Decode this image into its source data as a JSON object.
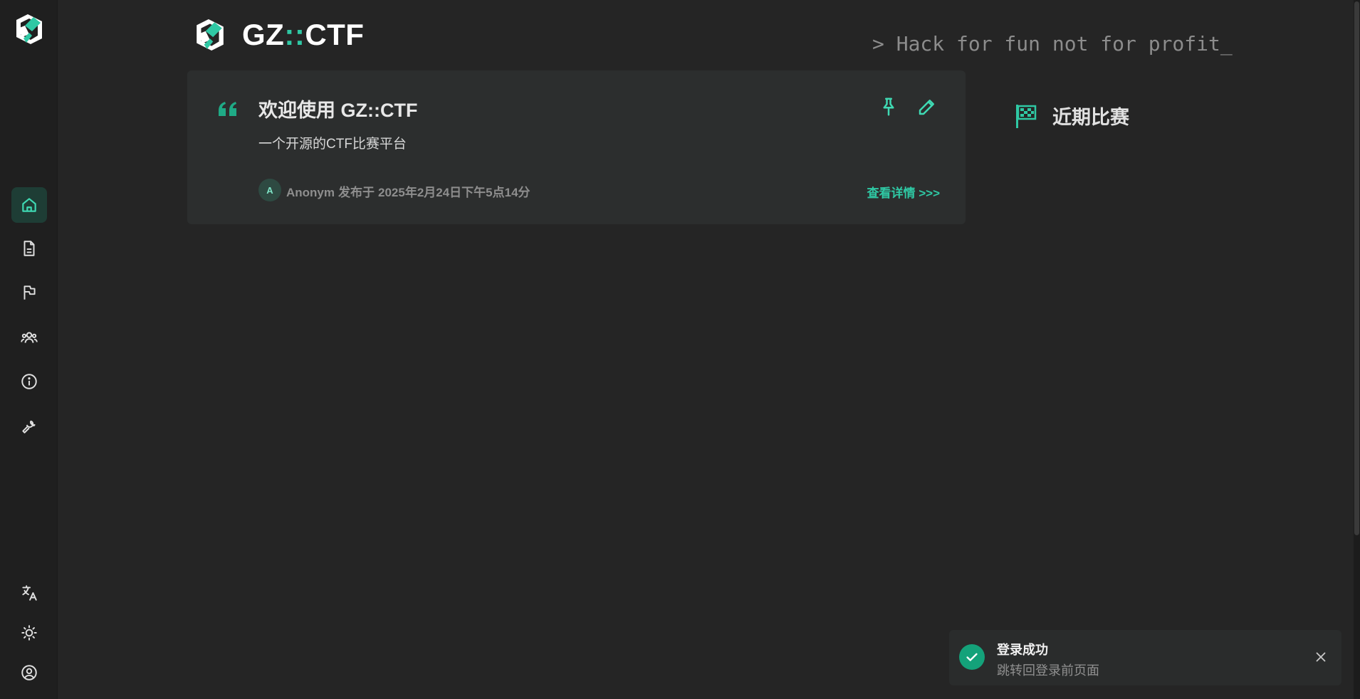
{
  "app": {
    "brand_prefix": "GZ",
    "brand_sep": "::",
    "brand_suffix": "CTF",
    "slogan": "> Hack for fun not for profit_",
    "accent_color": "#2fc8a4"
  },
  "sidebar": {
    "items": [
      {
        "icon": "home-icon",
        "active": true
      },
      {
        "icon": "posts-icon"
      },
      {
        "icon": "games-flag-icon"
      },
      {
        "icon": "teams-icon"
      },
      {
        "icon": "about-icon"
      },
      {
        "icon": "admin-wrench-icon"
      }
    ],
    "bottom": [
      {
        "icon": "language-icon"
      },
      {
        "icon": "theme-icon"
      },
      {
        "icon": "account-icon"
      }
    ]
  },
  "post": {
    "title": "欢迎使用 GZ::CTF",
    "summary": "一个开源的CTF比赛平台",
    "avatar_letter": "A",
    "author": "Anonym",
    "published_prefix": "发布于",
    "published_time": "2025年2月24日下午5点14分",
    "details_link": "查看详情 >>>"
  },
  "recent": {
    "title": "近期比赛"
  },
  "toast": {
    "title": "登录成功",
    "message": "跳转回登录前页面"
  }
}
